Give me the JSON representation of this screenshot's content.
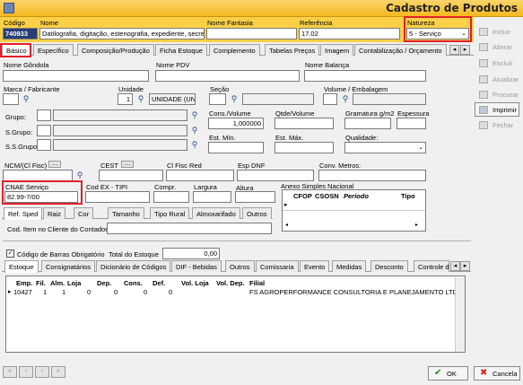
{
  "window": {
    "title": "Cadastro de Produtos"
  },
  "header": {
    "codigo_label": "Código",
    "codigo_value": "740933",
    "nome_label": "Nome",
    "nome_value": "Datilografia, digitação, estenografia, expediente, secreta",
    "nome_fantasia_label": "Nome Fantasia",
    "nome_fantasia_value": "",
    "referencia_label": "Referência",
    "referencia_value": "17.02",
    "natureza_label": "Natureza",
    "natureza_value": "5 - Serviço"
  },
  "main_tabs": [
    "Básico",
    "Específico",
    "Composição/Produção",
    "Ficha Estoque",
    "Complemento",
    "Tabelas Preços",
    "Imagem",
    "Contabilização / Orçamento"
  ],
  "fields": {
    "nome_gondola": "Nome Gôndola",
    "nome_pdv": "Nome PDV",
    "nome_balanca": "Nome Balança",
    "marca": "Marca / Fabricante",
    "unidade": "Unidade",
    "unidade_value": "1",
    "unidade_desc": "UNIDADE (UN",
    "secao": "Seção",
    "volume": "Volume / Embalagem",
    "grupo": "Grupo:",
    "sgrupo": "S.Grupo:",
    "ssgrupo": "S.S.Grupo:",
    "cons_volume": "Cons./Volume",
    "cons_volume_value": "1,000000",
    "qtde_volume": "Qtde/Volume",
    "gramatura": "Gramatura g/m2",
    "espessura": "Espessura",
    "est_min": "Est. Mín.",
    "est_max": "Est. Máx.",
    "qualidade": "Qualidade:",
    "ncm": "NCM/(Cl Fisc)",
    "cest": "CEST",
    "cl_fisc_red": "Cl Fisc Red",
    "esp_dnf": "Esp DNF",
    "conv_metros": "Conv. Metros:",
    "cnae": "CNAE Serviço",
    "cnae_value": "82.99-7/00",
    "cod_ex": "Cod EX - TIPI",
    "compr": "Compr.",
    "largura": "Largura",
    "altura": "Altura",
    "anexo": "Anexo Simples Nacional",
    "cod_item_cliente": "Cod. Item no Cliente do Contador:",
    "codigo_barras": "Código de Barras Obrigatório",
    "total_estoque": "Total do Estoque",
    "total_estoque_value": "0,00"
  },
  "anexo_cols": [
    "CFOP",
    "CSOSN",
    "Período",
    "Tipo"
  ],
  "sub_tabs": [
    "Ref. Sped",
    "Raiz",
    "Cor",
    "Tamanho",
    "Tipo Rural",
    "Almoxarifado",
    "Outros"
  ],
  "bottom_tabs": [
    "Estoque",
    "Consignatários",
    "Dicionário de Códigos",
    "DIF - Bebidas",
    "Outros",
    "Comissaria",
    "Evento",
    "Medidas",
    "Desconto",
    "Controle de"
  ],
  "stock_table": {
    "headers": [
      "Emp.",
      "Fil.",
      "Alm.",
      "Loja",
      "Dep.",
      "Cons.",
      "Def.",
      "Vol. Loja",
      "Vol. Dep.",
      "Filial"
    ],
    "rows": [
      [
        "10427",
        "1",
        "1",
        "0",
        "0",
        "0",
        "0",
        "",
        "",
        "FS AGROPERFORMANCE CONSULTORIA E PLANEJAMENTO LTDA"
      ]
    ]
  },
  "right_buttons": [
    "Incluir",
    "Alterar",
    "Excluir",
    "Atualizar",
    "Procurar",
    "Imprimir",
    "Fechar"
  ],
  "footer": {
    "ok": "OK",
    "cancel": "Cancela"
  }
}
